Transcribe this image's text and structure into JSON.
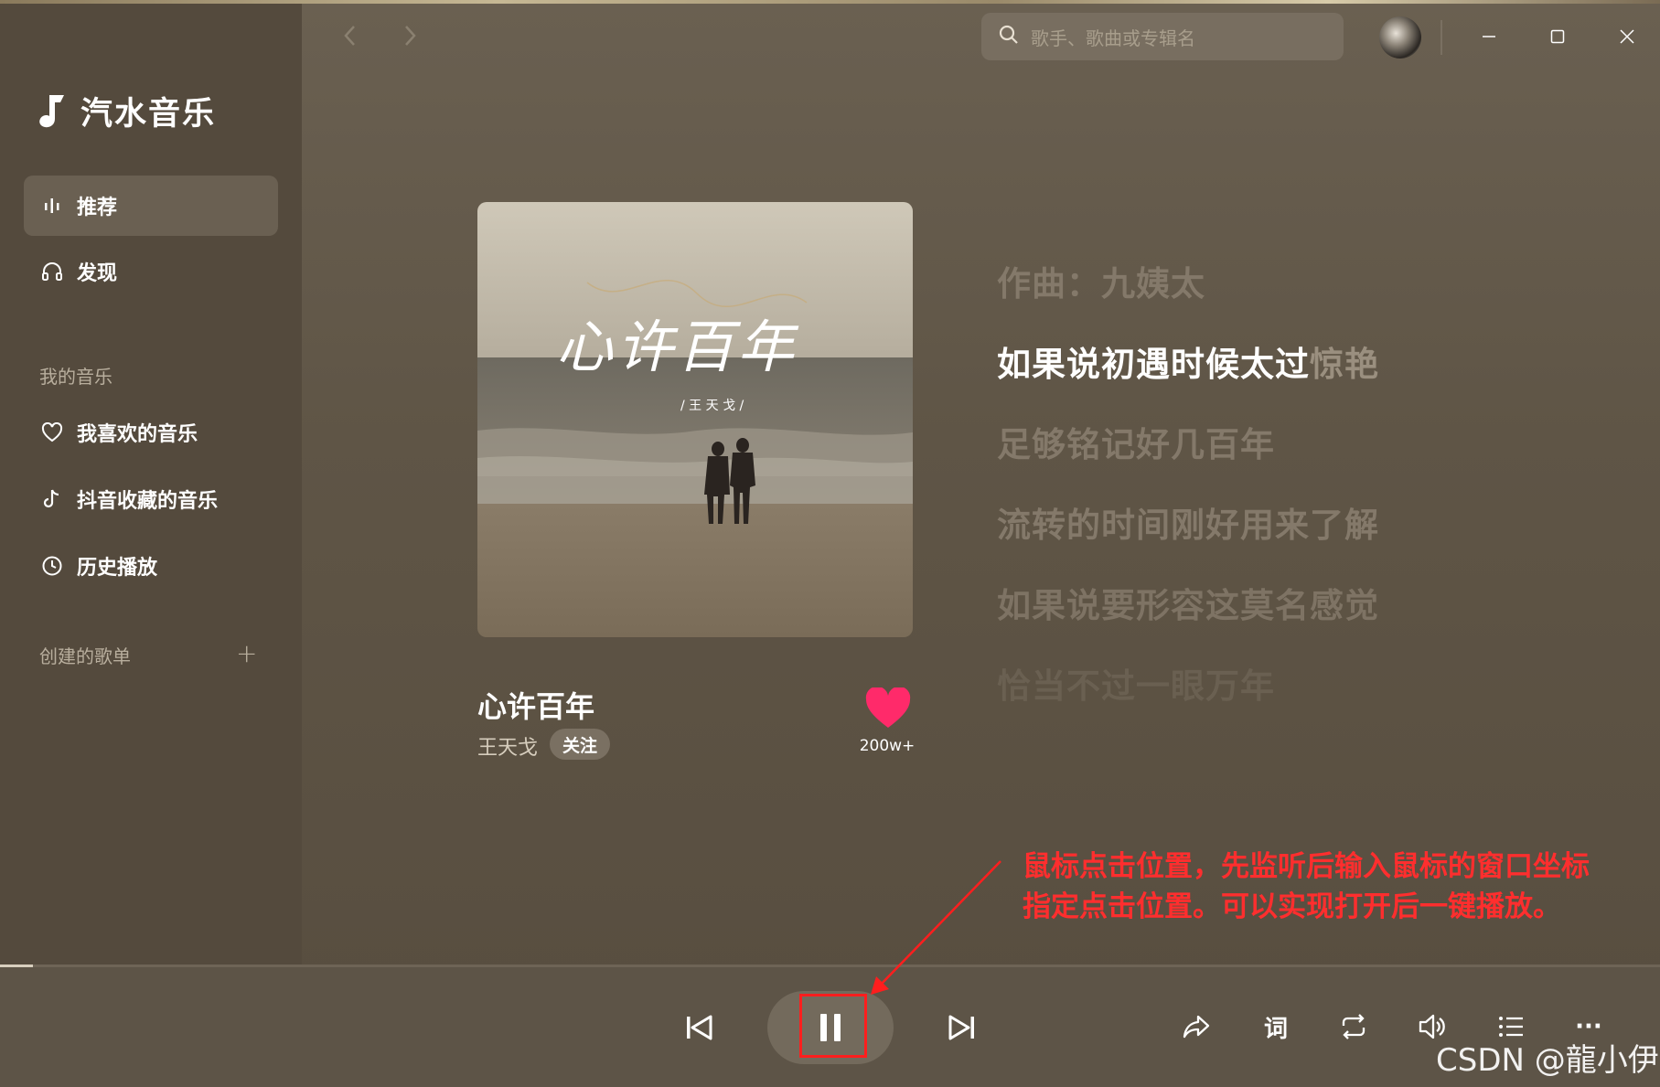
{
  "app": {
    "name": "汽水音乐"
  },
  "nav": {
    "back_icon": "chevron-left-icon",
    "forward_icon": "chevron-right-icon",
    "items": [
      {
        "label": "推荐",
        "icon": "equalizer-icon",
        "active": true
      },
      {
        "label": "发现",
        "icon": "headphones-icon",
        "active": false
      }
    ]
  },
  "my_music": {
    "label": "我的音乐",
    "items": [
      {
        "label": "我喜欢的音乐",
        "icon": "heart-outline-icon"
      },
      {
        "label": "抖音收藏的音乐",
        "icon": "tiktok-note-icon"
      },
      {
        "label": "历史播放",
        "icon": "clock-icon"
      }
    ]
  },
  "playlists": {
    "label": "创建的歌单",
    "add_icon": "plus-icon"
  },
  "search": {
    "placeholder": "歌手、歌曲或专辑名"
  },
  "window_controls": [
    "minimize-icon",
    "maximize-icon",
    "close-icon"
  ],
  "song": {
    "title": "心许百年",
    "artist": "王天戈",
    "follow_label": "关注",
    "likes": "200w+",
    "cover_title": "心许百年",
    "cover_subtitle": "/ 王 天 戈 /"
  },
  "lyrics": {
    "composer": "作曲：九姨太",
    "current_sung": "如果说初遇时候太过",
    "current_rest": "惊艳",
    "lines": [
      "足够铭记好几百年",
      "流转的时间刚好用来了解",
      "如果说要形容这莫名感觉",
      "恰当不过一眼万年"
    ]
  },
  "annotation": {
    "line1": "鼠标点击位置，先监听后输入鼠标的窗口坐标",
    "line2": "指定点击位置。可以实现打开后一键播放。"
  },
  "player": {
    "progress": 0.02,
    "controls": [
      "previous-icon",
      "pause-icon",
      "next-icon"
    ],
    "right_controls": [
      "share-icon",
      "lyrics-icon",
      "repeat-icon",
      "volume-icon",
      "playlist-icon",
      "more-icon"
    ],
    "lyrics_label": "词",
    "more_label": "···"
  },
  "watermark": "CSDN @龍小伊",
  "colors": {
    "accent_heart": "#ff2a6a",
    "annotation_red": "#ff2e2e"
  }
}
